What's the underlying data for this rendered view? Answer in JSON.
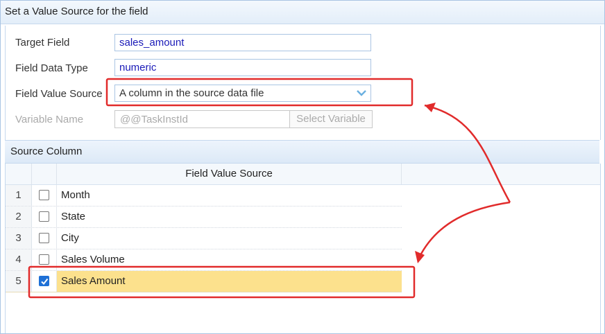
{
  "dialog": {
    "title": "Set a Value Source for the field"
  },
  "form": {
    "target_field_label": "Target Field",
    "target_field_value": "sales_amount",
    "data_type_label": "Field Data Type",
    "data_type_value": "numeric",
    "value_source_label": "Field Value Source",
    "value_source_value": "A column in the source data file",
    "variable_label": "Variable Name",
    "variable_value": "@@TaskInstId",
    "select_variable_button": "Select Variable"
  },
  "source_column": {
    "section_title": "Source Column",
    "column_header": "Field Value Source",
    "rows": [
      {
        "num": "1",
        "name": "Month",
        "checked": false
      },
      {
        "num": "2",
        "name": "State",
        "checked": false
      },
      {
        "num": "3",
        "name": "City",
        "checked": false
      },
      {
        "num": "4",
        "name": "Sales Volume",
        "checked": false
      },
      {
        "num": "5",
        "name": "Sales Amount",
        "checked": true
      }
    ]
  },
  "colors": {
    "highlight_box": "#e12b2b",
    "selected_row": "#fce18d",
    "checkbox_checked": "#1e70d6"
  },
  "icons": {
    "dropdown": "chevron-down-icon",
    "check": "check-icon"
  }
}
